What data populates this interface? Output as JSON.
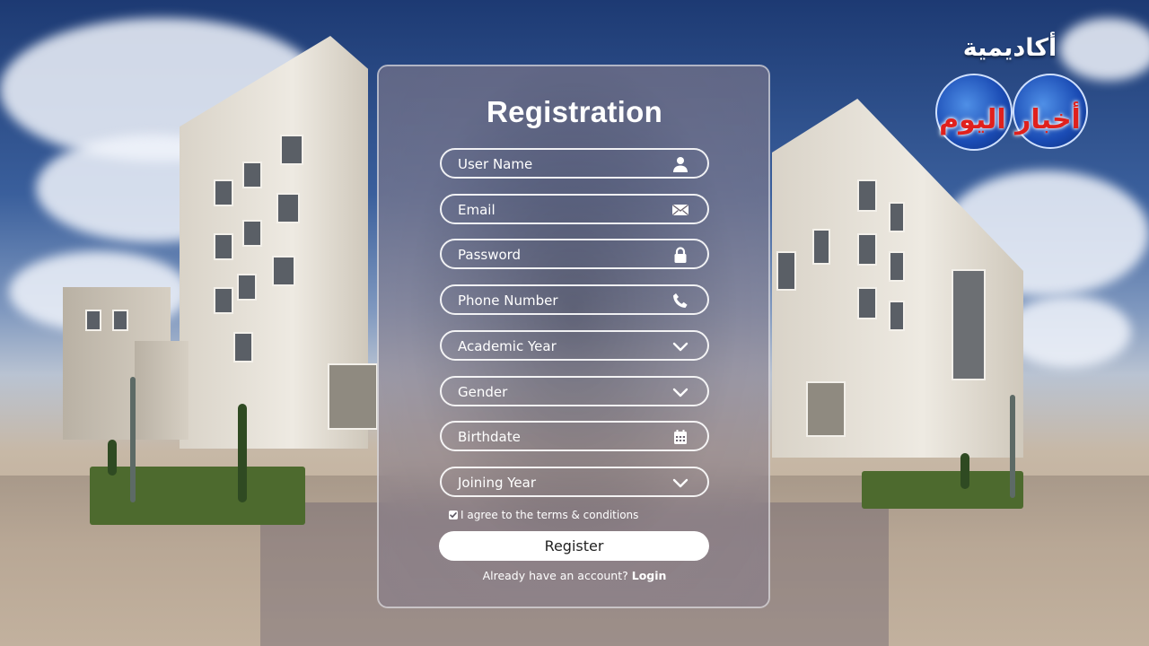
{
  "form": {
    "title": "Registration",
    "fields": [
      {
        "label": "User Name",
        "icon": "user-icon"
      },
      {
        "label": "Email",
        "icon": "envelope-icon"
      },
      {
        "label": "Password",
        "icon": "lock-icon"
      },
      {
        "label": "Phone Number",
        "icon": "phone-icon"
      },
      {
        "label": "Academic Year",
        "icon": "chevron-down-icon"
      },
      {
        "label": "Gender",
        "icon": "chevron-down-icon"
      },
      {
        "label": "Birthdate",
        "icon": "calendar-icon"
      },
      {
        "label": "Joining Year",
        "icon": "chevron-down-icon"
      }
    ],
    "terms_label": "I agree to the terms & conditions",
    "terms_checked": true,
    "register_label": "Register",
    "login_prompt": "Already have an account?",
    "login_link": "Login"
  },
  "logo": {
    "line1": "أكاديمية",
    "line2": "أخبار اليوم"
  },
  "colors": {
    "logo_red": "#e0211d",
    "panel_border": "#ffffff",
    "button_bg": "#ffffff"
  }
}
